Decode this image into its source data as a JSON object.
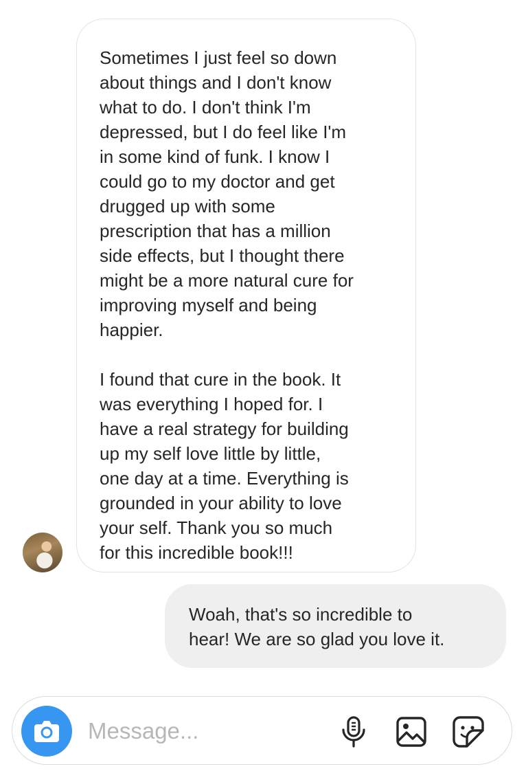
{
  "thread": {
    "incoming": {
      "paragraphs": [
        "Sometimes I just feel so down\nabout things and I don't know\nwhat to do. I don't think I'm\ndepressed, but I do feel like I'm\nin some kind of funk. I know I\ncould go to my doctor and get\ndrugged up with some\nprescription that has a million\nside effects, but I thought there\nmight be a more natural cure for\nimproving myself and being\nhappier.",
        "I found that cure in the book. It\nwas everything I hoped for. I\nhave a real strategy for building\nup my self love little by little,\none day at a time. Everything is\ngrounded in your ability to love\nyour self. Thank you so much\nfor this incredible book!!!"
      ]
    },
    "outgoing": {
      "text": "Woah, that's so incredible to\nhear! We are so glad you love it."
    }
  },
  "composer": {
    "placeholder": "Message...",
    "value": "",
    "icons": {
      "camera": "camera-icon",
      "mic": "microphone-icon",
      "gallery": "gallery-icon",
      "sticker": "sticker-icon"
    }
  },
  "colors": {
    "accent": "#3797f0",
    "outgoing_bubble": "#efefef",
    "incoming_border": "#e3e3e3",
    "text": "#262626",
    "placeholder": "#b7b7b7"
  }
}
